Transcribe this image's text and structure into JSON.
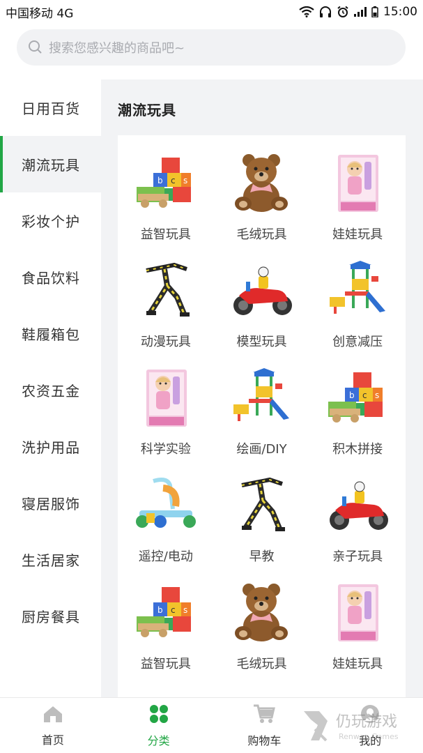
{
  "status_bar": {
    "carrier": "中国移动 4G",
    "time": "15:00"
  },
  "search": {
    "placeholder": "搜索您感兴趣的商品吧~"
  },
  "sidebar": {
    "items": [
      {
        "label": "日用百货",
        "active": false
      },
      {
        "label": "潮流玩具",
        "active": true
      },
      {
        "label": "彩妆个护",
        "active": false
      },
      {
        "label": "食品饮料",
        "active": false
      },
      {
        "label": "鞋履箱包",
        "active": false
      },
      {
        "label": "农资五金",
        "active": false
      },
      {
        "label": "洗护用品",
        "active": false
      },
      {
        "label": "寝居服饰",
        "active": false
      },
      {
        "label": "生活居家",
        "active": false
      },
      {
        "label": "厨房餐具",
        "active": false
      }
    ]
  },
  "main": {
    "title": "潮流玩具",
    "products": [
      {
        "label": "益智玩具",
        "icon": "blocks-cart"
      },
      {
        "label": "毛绒玩具",
        "icon": "teddy-bear"
      },
      {
        "label": "娃娃玩具",
        "icon": "doll-box"
      },
      {
        "label": "动漫玩具",
        "icon": "robot-figure"
      },
      {
        "label": "模型玩具",
        "icon": "motorbike"
      },
      {
        "label": "创意减压",
        "icon": "playground"
      },
      {
        "label": "科学实验",
        "icon": "doll-box"
      },
      {
        "label": "绘画/DIY",
        "icon": "playground"
      },
      {
        "label": "积木拼接",
        "icon": "blocks-cart"
      },
      {
        "label": "遥控/电动",
        "icon": "ride-on"
      },
      {
        "label": "早教",
        "icon": "robot-figure"
      },
      {
        "label": "亲子玩具",
        "icon": "motorbike"
      },
      {
        "label": "益智玩具",
        "icon": "blocks-cart"
      },
      {
        "label": "毛绒玩具",
        "icon": "teddy-bear"
      },
      {
        "label": "娃娃玩具",
        "icon": "doll-box"
      }
    ]
  },
  "bottom_nav": {
    "items": [
      {
        "label": "首页",
        "icon": "home-icon",
        "active": false
      },
      {
        "label": "分类",
        "icon": "category-icon",
        "active": true
      },
      {
        "label": "购物车",
        "icon": "cart-icon",
        "active": false
      },
      {
        "label": "我的",
        "icon": "user-icon",
        "active": false
      }
    ]
  },
  "watermark": {
    "text": "仍玩游戏",
    "sub": "Renwan Games"
  },
  "colors": {
    "accent": "#22a645",
    "panel_bg": "#f2f3f5"
  }
}
